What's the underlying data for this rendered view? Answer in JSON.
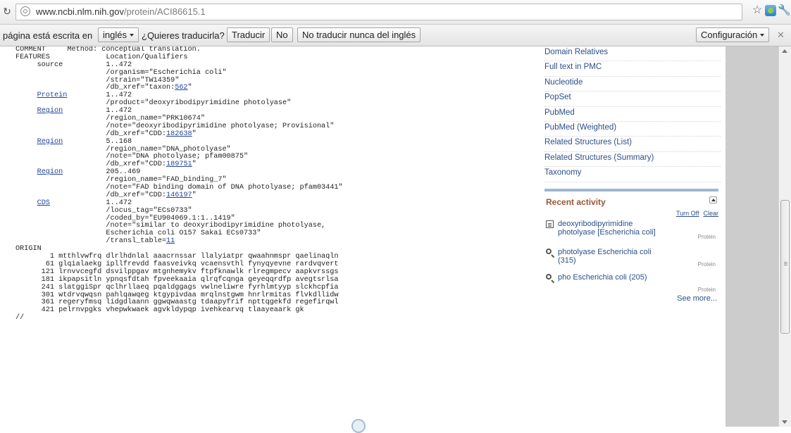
{
  "browser": {
    "url_host": "www.ncbi.nlm.nih.gov",
    "url_path": "/protein/ACI86615.1"
  },
  "translate_bar": {
    "text_before": "página está escrita en",
    "language": "inglés",
    "question": "¿Quieres traducirla?",
    "translate_button": "Traducir",
    "no_button": "No",
    "never_button": "No traducir nunca del inglés",
    "settings_button": "Configuración"
  },
  "flatfile": {
    "lines": [
      {
        "text": "COMMENT     Method: conceptual translation."
      },
      {
        "text": "FEATURES             Location/Qualifiers"
      },
      {
        "text": "     source          1..472"
      },
      {
        "text": "                     /organism=\"Escherichia coli\""
      },
      {
        "text": "                     /strain=\"TW14359\""
      },
      {
        "text": "                     /db_xref=\"taxon:",
        "link": "562",
        "after": "\""
      },
      {
        "feature": "Protein",
        "pre": "     ",
        "text": "         1..472"
      },
      {
        "text": "                     /product=\"deoxyribodipyrimidine photolyase\""
      },
      {
        "feature": "Region",
        "pre": "     ",
        "text": "          1..472"
      },
      {
        "text": "                     /region_name=\"PRK10674\""
      },
      {
        "text": "                     /note=\"deoxyribodipyrimidine photolyase; Provisional\""
      },
      {
        "text": "                     /db_xref=\"CDD:",
        "link": "182638",
        "after": "\""
      },
      {
        "feature": "Region",
        "pre": "     ",
        "text": "          5..168"
      },
      {
        "text": "                     /region_name=\"DNA_photolyase\""
      },
      {
        "text": "                     /note=\"DNA photolyase; pfam00875\""
      },
      {
        "text": "                     /db_xref=\"CDD:",
        "link": "189751",
        "after": "\""
      },
      {
        "feature": "Region",
        "pre": "     ",
        "text": "          205..469"
      },
      {
        "text": "                     /region_name=\"FAD_binding_7\""
      },
      {
        "text": "                     /note=\"FAD binding domain of DNA photolyase; pfam03441\""
      },
      {
        "text": "                     /db_xref=\"CDD:",
        "link": "146197",
        "after": "\""
      },
      {
        "feature": "CDS",
        "pre": "     ",
        "text": "             1..472"
      },
      {
        "text": "                     /locus_tag=\"ECs0733\""
      },
      {
        "text": "                     /coded_by=\"EU904069.1:1..1419\""
      },
      {
        "text": "                     /note=\"similar to deoxyribodipyrimidine photolyase,"
      },
      {
        "text": "                     Escherichia coli O157 Sakai ECs0733\""
      },
      {
        "text": "                     /transl_table=",
        "link": "11",
        "after": ""
      },
      {
        "text": "ORIGIN"
      },
      {
        "text": "        1 mtthlvwfrq dlrlhdnlal aaacrnssar llalyiatpr qwaahnmspr qaelinaqln"
      },
      {
        "text": "       61 glqialaekg ipllfrevdd faasveivkq vcaensvthl fynyqyevne rardvqvert"
      },
      {
        "text": "      121 lrnvvcegfd dsvilppgav mtgnhemykv ftpfknawlk rlregmpecv aapkvrssgs"
      },
      {
        "text": "      181 ikpapsitln ypnqsfdtah fpveekaaia qlrqfcqnga geyeqqrdfp avegtsrlsa"
      },
      {
        "text": "      241 slatggiSpr qclhrllaeq pqaldggags vwlneliwre fyrhlmtyyp slckhcpfia"
      },
      {
        "text": "      301 wtdrvqwqsn pahlqawqeg ktgypivdaa mrqlnstgwm hnrlrmitas flvkdllidw"
      },
      {
        "text": "      361 regeryfmsq lidgdlaann ggwqwaastg tdaapyfrif npttqgekfd regefirqwl"
      },
      {
        "text": "      421 pelrnvpgks vhepwkwaek agvkldypqp ivehkearvq tlaayeaark gk"
      },
      {
        "text": "//"
      }
    ]
  },
  "right_column": {
    "links": [
      "Domain Relatives",
      "Full text in PMC",
      "Nucleotide",
      "PopSet",
      "PubMed",
      "PubMed (Weighted)",
      "Related Structures (List)",
      "Related Structures (Summary)",
      "Taxonomy"
    ],
    "recent_activity": {
      "title": "Recent activity",
      "turn_off": "Turn Off",
      "clear": "Clear",
      "items": [
        {
          "icon": "document-icon",
          "label": "deoxyribodipyrimidine photolyase [Escherichia coli]",
          "type": "Protein"
        },
        {
          "icon": "search-icon",
          "label": "photolyase Escherichia coli (315)",
          "type": "Protein"
        },
        {
          "icon": "search-icon",
          "label": "pho Escherichia coli (205)",
          "type": "Protein"
        }
      ],
      "see_more": "See more..."
    }
  }
}
